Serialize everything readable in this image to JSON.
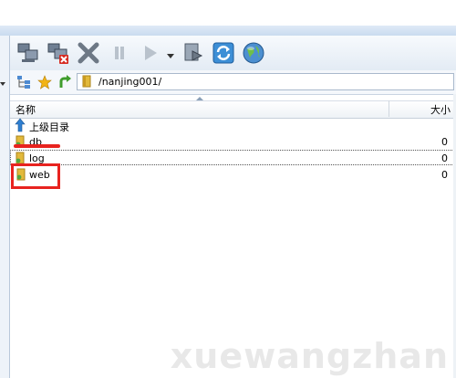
{
  "address": {
    "path": "/nanjing001/"
  },
  "columns": {
    "name": "名称",
    "size": "大小"
  },
  "rows": [
    {
      "label": "上级目录",
      "size": ""
    },
    {
      "label": "db",
      "size": "0"
    },
    {
      "label": "log",
      "size": "0"
    },
    {
      "label": "web",
      "size": "0"
    }
  ],
  "watermark": "xuewangzhan",
  "colors": {
    "accent_blue": "#2f7fd1",
    "annotation_red": "#e8231f",
    "folder": "#e2b93b"
  }
}
